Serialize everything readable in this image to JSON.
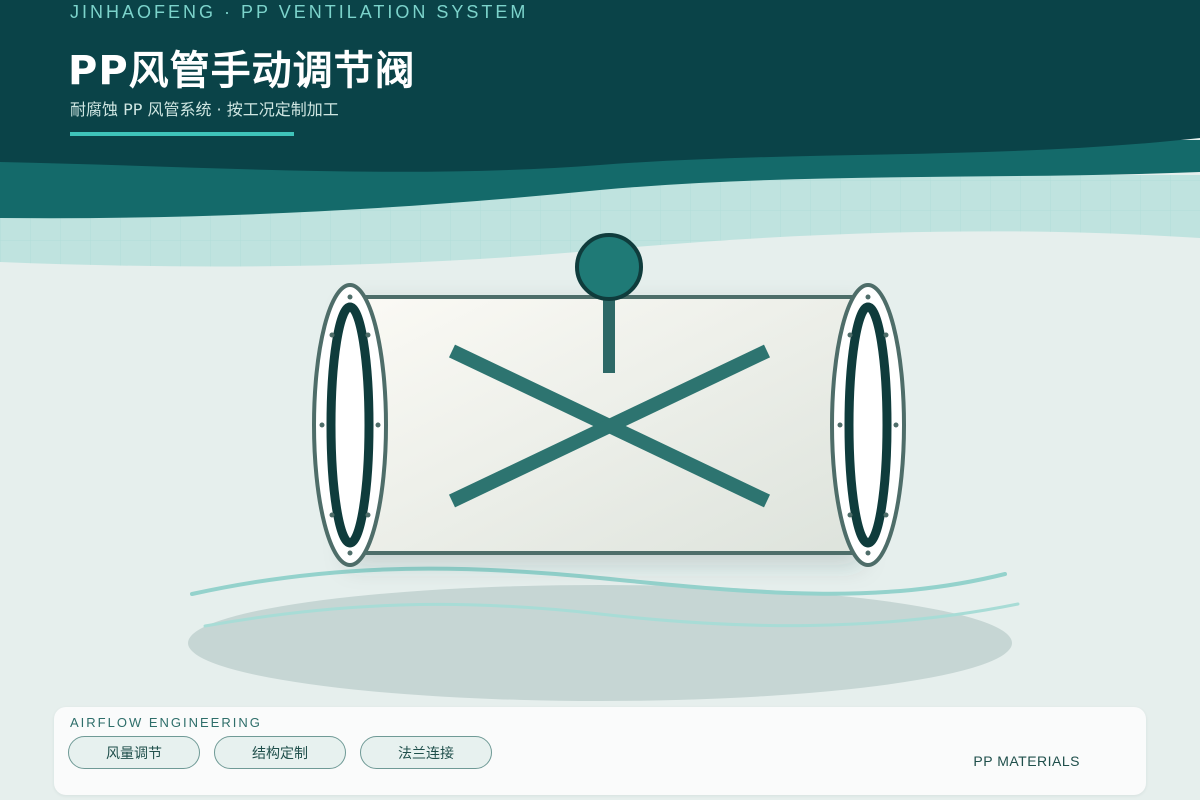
{
  "header": {
    "eyebrow": "JINHAOFENG · PP VENTILATION SYSTEM",
    "title": "PP风管手动调节阀",
    "subtitle": "耐腐蚀 PP 风管系统 · 按工况定制加工"
  },
  "illustration": {
    "subject": "manual-damper-valve",
    "colors": {
      "header_dark": "#0a4348",
      "teal_band": "#146a6a",
      "handle_knob": "#1f7a76",
      "x_blade": "#2d7470",
      "flange_ring": "#0f3c3c",
      "accent": "#3fc4ba"
    }
  },
  "info_panel": {
    "label": "AIRFLOW ENGINEERING",
    "tags": [
      "风量调节",
      "结构定制",
      "法兰连接"
    ],
    "meta": "PP MATERIALS"
  }
}
